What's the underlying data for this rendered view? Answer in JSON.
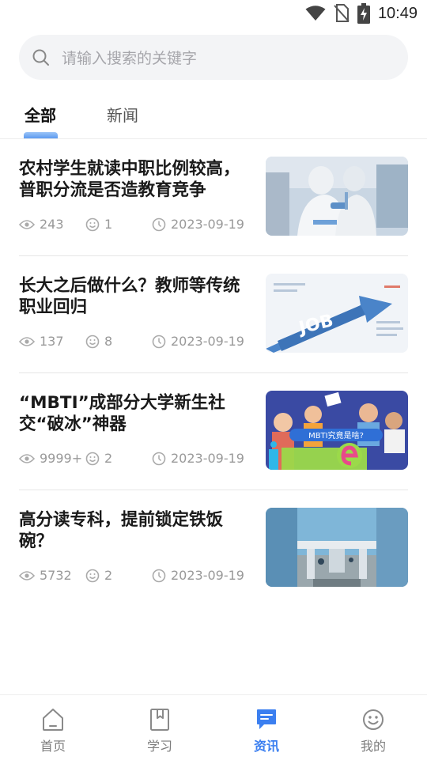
{
  "status_bar": {
    "time": "10:49",
    "icons": [
      "wifi-icon",
      "no-sim-icon",
      "battery-charging-icon"
    ]
  },
  "search": {
    "placeholder": "请输入搜索的关键字",
    "value": ""
  },
  "tabs": [
    {
      "label": "全部",
      "active": true
    },
    {
      "label": "新闻",
      "active": false
    }
  ],
  "news": [
    {
      "title": "农村学生就读中职比例较高，普职分流是否造教育竞争",
      "views": "243",
      "comments": "1",
      "date": "2023-09-19",
      "thumb": "lab-workers-photo"
    },
    {
      "title": "长大之后做什么？教师等传统职业回归",
      "views": "137",
      "comments": "8",
      "date": "2023-09-19",
      "thumb": "job-infographic"
    },
    {
      "title": "“MBTI”成部分大学新生社交“破冰”神器",
      "views": "9999+",
      "comments": "2",
      "date": "2023-09-19",
      "thumb": "mbti-illustration",
      "thumb_text": "MBTI究竟是啥?"
    },
    {
      "title": "高分读专科，提前锁定铁饭碗？",
      "views": "5732",
      "comments": "2",
      "date": "2023-09-19",
      "thumb": "college-gate-photo"
    }
  ],
  "bottom_nav": [
    {
      "label": "首页",
      "icon": "home-icon",
      "active": false
    },
    {
      "label": "学习",
      "icon": "book-icon",
      "active": false
    },
    {
      "label": "资讯",
      "icon": "message-icon",
      "active": true
    },
    {
      "label": "我的",
      "icon": "smiley-icon",
      "active": false
    }
  ],
  "colors": {
    "accent": "#3b7ff0",
    "meta_text": "#999999",
    "search_bg": "#f3f4f6"
  }
}
